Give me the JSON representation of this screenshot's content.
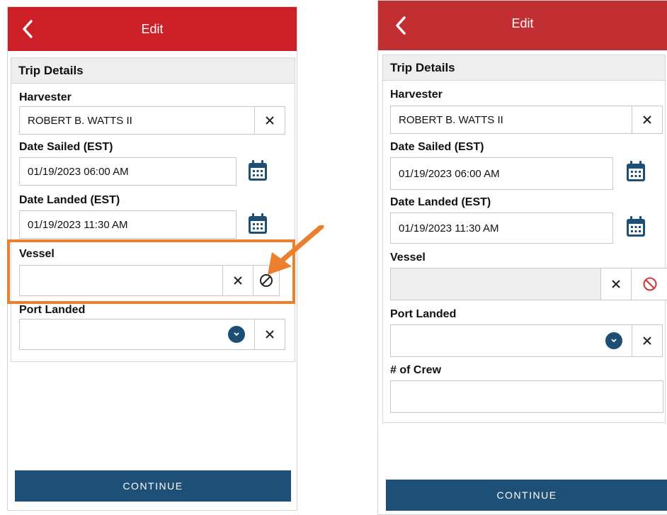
{
  "colors": {
    "appbar_red": "#cc1f27",
    "appbar_red_alt": "#c12f33",
    "primary_blue": "#1e4f76",
    "highlight_orange": "#ec7f2e",
    "ban_red": "#d1343a"
  },
  "left": {
    "header": {
      "title": "Edit",
      "back_icon": "chevron-left-icon"
    },
    "section_title": "Trip Details",
    "harvester": {
      "label": "Harvester",
      "value": "ROBERT B. WATTS II"
    },
    "date_sailed": {
      "label": "Date Sailed (EST)",
      "value": "01/19/2023 06:00 AM"
    },
    "date_landed": {
      "label": "Date Landed (EST)",
      "value": "01/19/2023 11:30 AM"
    },
    "vessel": {
      "label": "Vessel",
      "value": ""
    },
    "port_landed": {
      "label": "Port Landed",
      "value": ""
    },
    "continue_label": "CONTINUE"
  },
  "right": {
    "header": {
      "title": "Edit",
      "back_icon": "chevron-left-icon"
    },
    "section_title": "Trip Details",
    "harvester": {
      "label": "Harvester",
      "value": "ROBERT B. WATTS II"
    },
    "date_sailed": {
      "label": "Date Sailed (EST)",
      "value": "01/19/2023 06:00 AM"
    },
    "date_landed": {
      "label": "Date Landed (EST)",
      "value": "01/19/2023 11:30 AM"
    },
    "vessel": {
      "label": "Vessel",
      "value": ""
    },
    "port_landed": {
      "label": "Port Landed",
      "value": ""
    },
    "crew": {
      "label": "# of Crew",
      "value": ""
    },
    "continue_label": "CONTINUE"
  }
}
